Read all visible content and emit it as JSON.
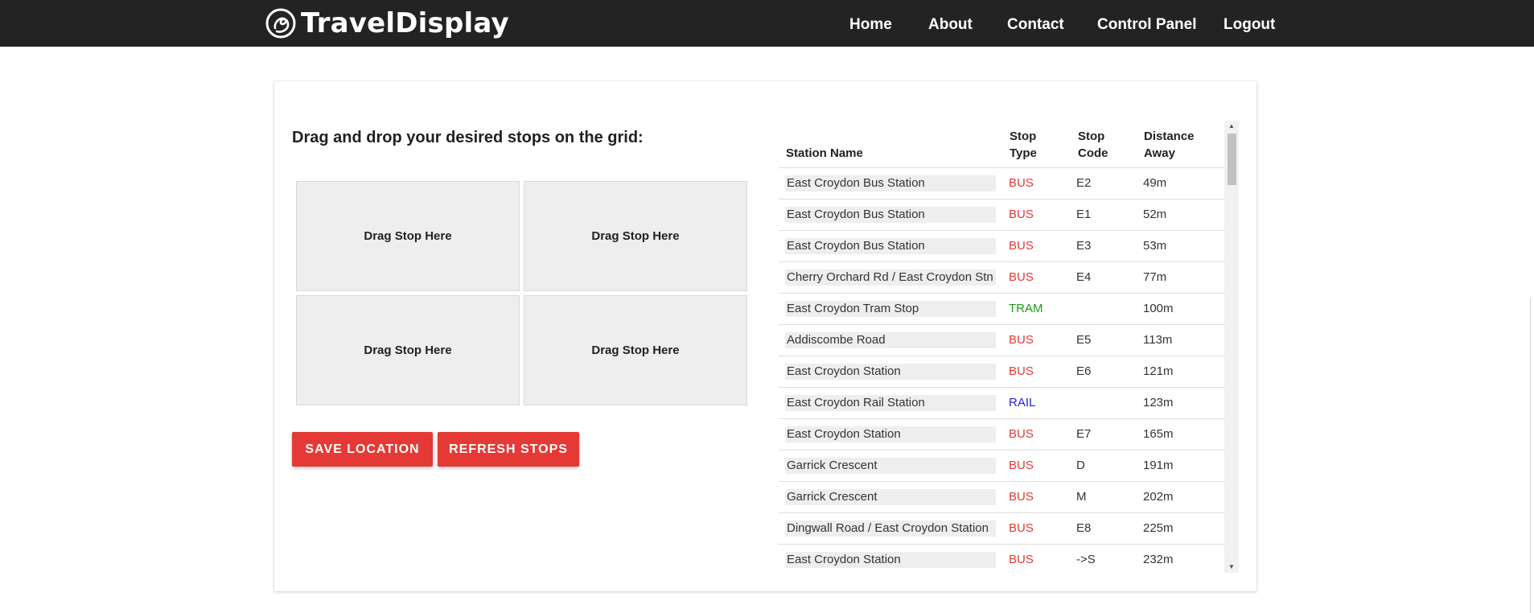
{
  "brand": {
    "name": "TravelDisplay",
    "logo_icon": "swirl-logo-icon"
  },
  "nav": {
    "items": [
      {
        "label": "Home"
      },
      {
        "label": "About"
      },
      {
        "label": "Contact"
      },
      {
        "label": "Control Panel"
      },
      {
        "label": "Logout"
      }
    ]
  },
  "main": {
    "heading": "Drag and drop your desired stops on the grid:",
    "grid": [
      {
        "label": "Drag Stop Here"
      },
      {
        "label": "Drag Stop Here"
      },
      {
        "label": "Drag Stop Here"
      },
      {
        "label": "Drag Stop Here"
      }
    ],
    "buttons": {
      "save": "Save Location",
      "refresh": "Refresh Stops"
    }
  },
  "stops_table": {
    "headers": {
      "name": "Station Name",
      "type_line1": "Stop",
      "type_line2": "Type",
      "code_line1": "Stop",
      "code_line2": "Code",
      "dist_line1": "Distance",
      "dist_line2": "Away"
    },
    "type_colors": {
      "BUS": "#e53935",
      "TRAM": "#1a9e1a",
      "RAIL": "#2222dd"
    },
    "rows": [
      {
        "name": "East Croydon Bus Station",
        "type": "BUS",
        "code": "E2",
        "distance": "49m"
      },
      {
        "name": "East Croydon Bus Station",
        "type": "BUS",
        "code": "E1",
        "distance": "52m"
      },
      {
        "name": "East Croydon Bus Station",
        "type": "BUS",
        "code": "E3",
        "distance": "53m"
      },
      {
        "name": "Cherry Orchard Rd / East Croydon Stn",
        "type": "BUS",
        "code": "E4",
        "distance": "77m"
      },
      {
        "name": "East Croydon Tram Stop",
        "type": "TRAM",
        "code": "",
        "distance": "100m"
      },
      {
        "name": "Addiscombe Road",
        "type": "BUS",
        "code": "E5",
        "distance": "113m"
      },
      {
        "name": "East Croydon Station",
        "type": "BUS",
        "code": "E6",
        "distance": "121m"
      },
      {
        "name": "East Croydon Rail Station",
        "type": "RAIL",
        "code": "",
        "distance": "123m"
      },
      {
        "name": "East Croydon Station",
        "type": "BUS",
        "code": "E7",
        "distance": "165m"
      },
      {
        "name": "Garrick Crescent",
        "type": "BUS",
        "code": "D",
        "distance": "191m"
      },
      {
        "name": "Garrick Crescent",
        "type": "BUS",
        "code": "M",
        "distance": "202m"
      },
      {
        "name": "Dingwall Road / East Croydon Station",
        "type": "BUS",
        "code": "E8",
        "distance": "225m"
      },
      {
        "name": "East Croydon Station",
        "type": "BUS",
        "code": "->S",
        "distance": "232m"
      }
    ]
  },
  "colors": {
    "topbar": "#232323",
    "accent": "#e53935",
    "tile": "#eeeeee"
  }
}
